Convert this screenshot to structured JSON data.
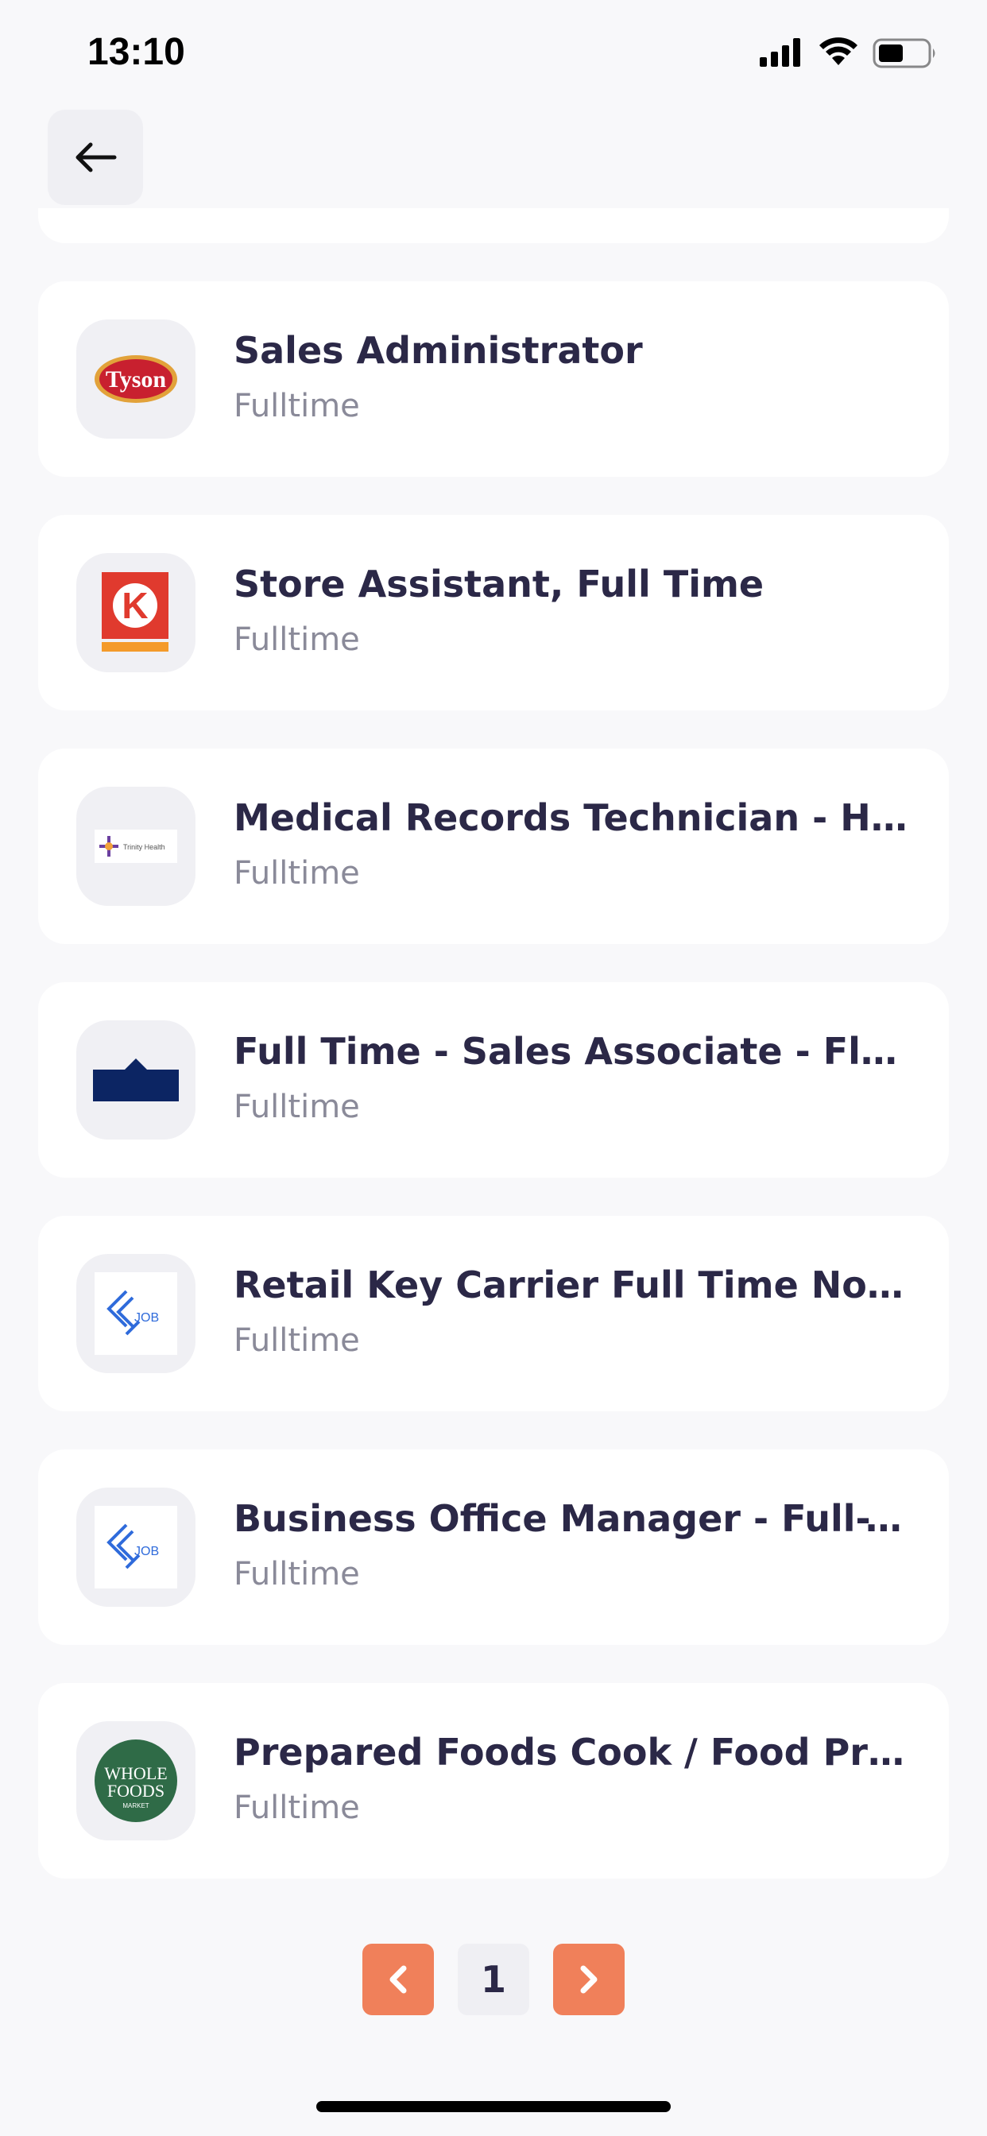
{
  "status_bar": {
    "time": "13:10"
  },
  "jobs": [
    {
      "title": "Sales Administrator",
      "type": "Fulltime",
      "logo": "tyson-logo",
      "logo_text": "Tyson"
    },
    {
      "title": "Store Assistant, Full Time",
      "type": "Fulltime",
      "logo": "circle-k-logo",
      "logo_text": "K"
    },
    {
      "title": "Medical Records Technician - HI...",
      "type": "Fulltime",
      "logo": "trinity-health-logo",
      "logo_text": "Trinity Health"
    },
    {
      "title": "Full Time - Sales Associate - Floo...",
      "type": "Fulltime",
      "logo": "store-building-logo"
    },
    {
      "title": "Retail Key Carrier Full Time Now...",
      "type": "Fulltime",
      "logo": "job-logo",
      "logo_text": "JOB"
    },
    {
      "title": "Business Office Manager - Full-Ti...",
      "type": "Fulltime",
      "logo": "job-logo",
      "logo_text": "JOB"
    },
    {
      "title": "Prepared Foods Cook / Food Pro...",
      "type": "Fulltime",
      "logo": "whole-foods-logo",
      "logo_text": "WHOLE FOODS MARKET"
    }
  ],
  "pagination": {
    "current_page": "1",
    "prev_icon": "chevron-left-icon",
    "next_icon": "chevron-right-icon"
  },
  "colors": {
    "accent": "#f0805a",
    "title": "#2b2847",
    "subtitle": "#8a8a99",
    "background": "#f8f8fa"
  }
}
